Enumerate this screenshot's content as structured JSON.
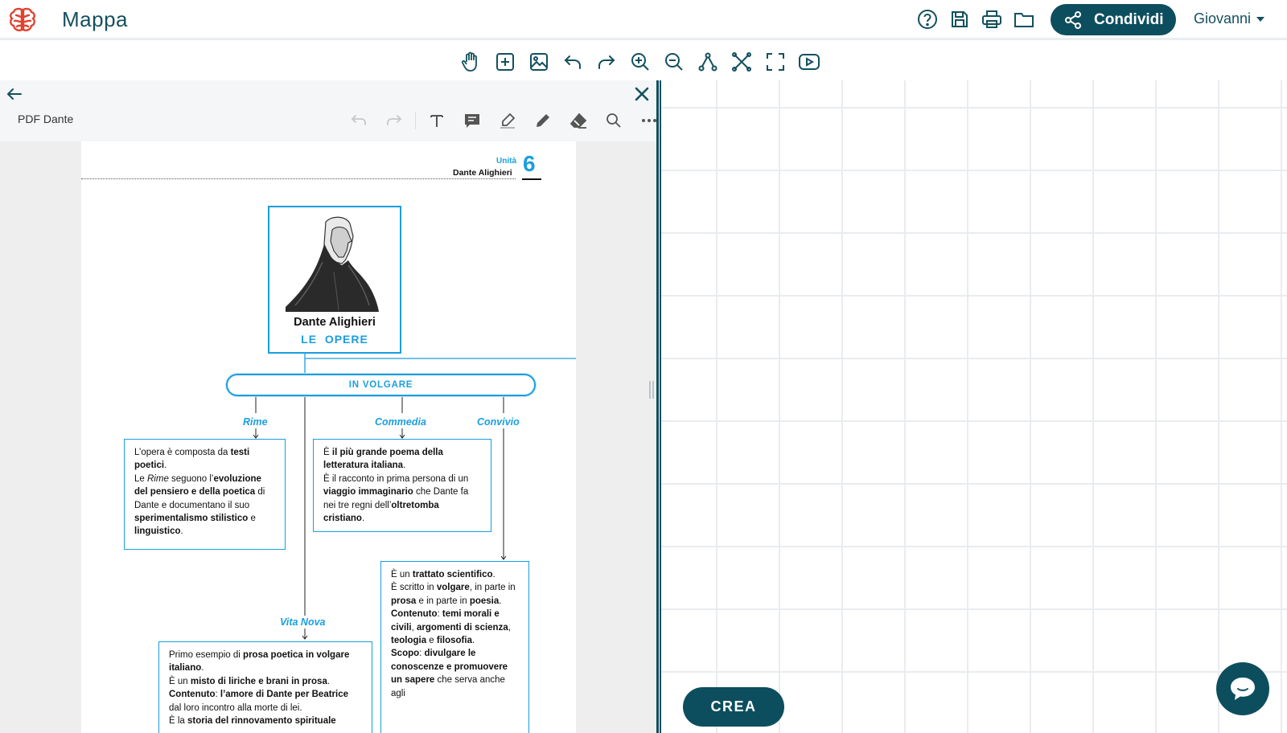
{
  "header": {
    "app_title": "Mappa",
    "icons": [
      "help-icon",
      "save-icon",
      "print-icon",
      "folder-icon"
    ],
    "share_label": "Condividi",
    "user_name": "Giovanni"
  },
  "map_toolbar": {
    "tools": [
      "hand-icon",
      "add-node-icon",
      "image-icon",
      "undo-icon",
      "redo-icon",
      "zoom-in-icon",
      "zoom-out-icon",
      "connect-icon",
      "fit-icon",
      "fullscreen-icon",
      "video-icon"
    ]
  },
  "pdf_panel": {
    "document_name": "PDF Dante",
    "tools": [
      "undo-icon",
      "redo-icon",
      "text-icon",
      "comment-icon",
      "highlighter-icon",
      "pencil-icon",
      "eraser-icon",
      "search-icon",
      "more-icon"
    ]
  },
  "pdf_page": {
    "unit_label": "Unità",
    "unit_number": "6",
    "unit_author": "Dante Alighieri",
    "portrait_name": "Dante Alighieri",
    "portrait_subtitle": "LE  OPERE",
    "category": "IN VOLGARE",
    "branches": {
      "rime": "Rime",
      "commedia": "Commedia",
      "convivio": "Convivio",
      "vita_nova": "Vita Nova"
    }
  },
  "canvas": {
    "create_label": "CREA"
  },
  "colors": {
    "primary": "#0d4e5e",
    "accent": "#1a9ee0",
    "logo": "#e3412f"
  }
}
